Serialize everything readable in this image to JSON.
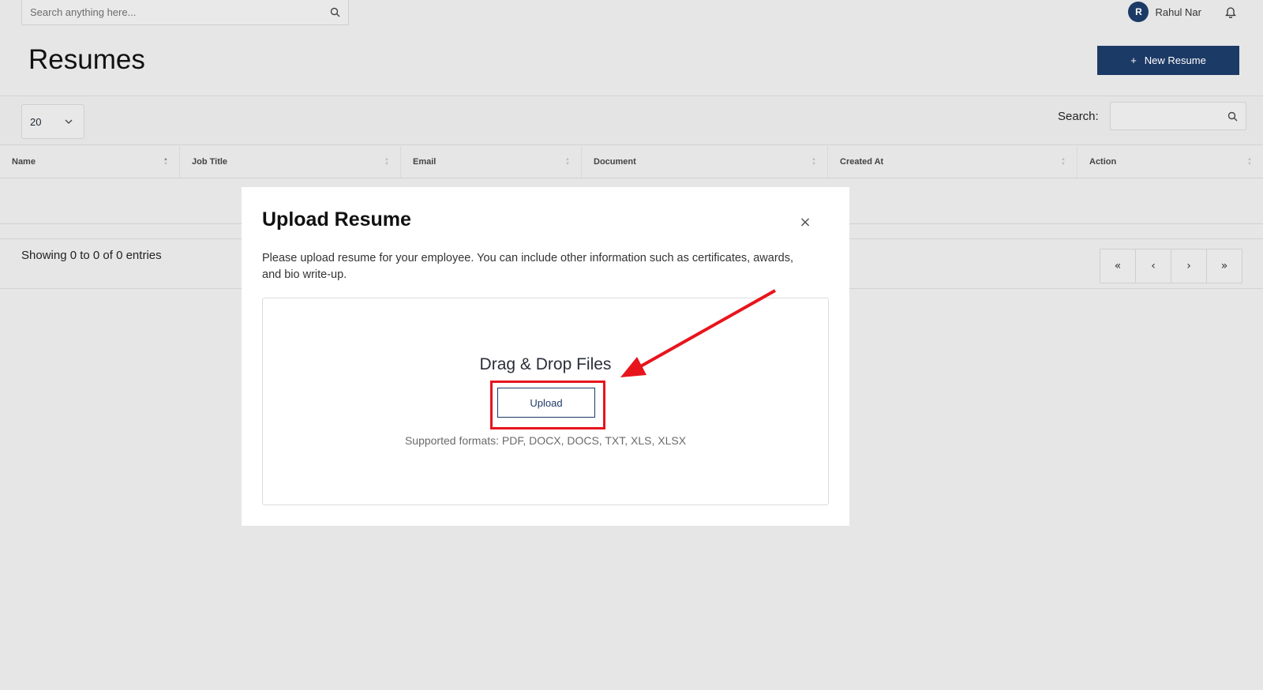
{
  "topbar": {
    "search_placeholder": "Search anything here...",
    "user_initial": "R",
    "user_name": "Rahul Nar"
  },
  "page": {
    "title": "Resumes",
    "new_button_label": "New Resume"
  },
  "toolbar": {
    "page_size": "20",
    "search_label": "Search:"
  },
  "table": {
    "columns": [
      "Name",
      "Job Title",
      "Email",
      "Document",
      "Created At",
      "Action"
    ]
  },
  "footer": {
    "entries_text": "Showing 0 to 0 of 0 entries",
    "pager": {
      "first": "«",
      "prev": "‹",
      "next": "›",
      "last": "»"
    }
  },
  "modal": {
    "title": "Upload Resume",
    "close_label": "×",
    "description": "Please upload resume for your employee. You can include other information such as certificates, awards, and bio write-up.",
    "dropzone_title": "Drag & Drop Files",
    "upload_label": "Upload",
    "formats": "Supported formats: PDF, DOCX, DOCS, TXT, XLS, XLSX"
  },
  "colors": {
    "brand": "#1c3a66",
    "annotation": "#e8141c"
  }
}
